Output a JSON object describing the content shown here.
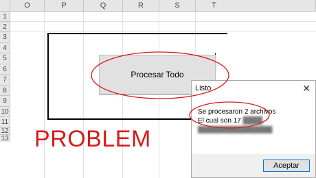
{
  "columns": [
    "O",
    "P",
    "Q",
    "R",
    "S",
    "T"
  ],
  "rows": [
    "1",
    "2",
    "3",
    "4",
    "5",
    "6",
    "7",
    "8",
    "9",
    "10",
    "11",
    "12",
    "13"
  ],
  "sheet": {
    "button_label": "Procesar Todo",
    "annotation_text": "PROBLEM"
  },
  "dialog": {
    "title": "Listo",
    "close_glyph": "✕",
    "line1": "Se procesaron 2 archivos",
    "line2_visible": "El cual son 17",
    "accept_label": "Aceptar"
  },
  "colors": {
    "annotation_red": "#d81a1a",
    "accept_border": "#0078d7"
  }
}
